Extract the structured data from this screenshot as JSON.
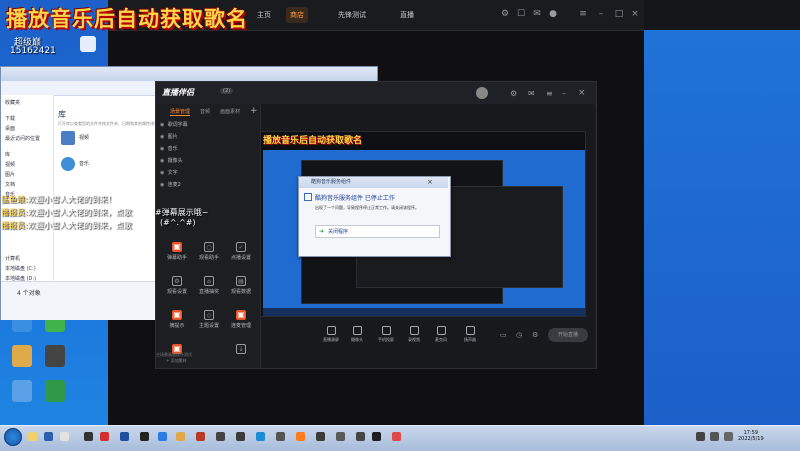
{
  "overlay": {
    "title": "播放音乐后自动获取歌名",
    "id_line1": "超级巅",
    "id_line2": "15162421"
  },
  "top_app": {
    "tabs": [
      "主页",
      "商店",
      "先锋测试",
      "直播"
    ]
  },
  "explorer": {
    "nav_items": [
      "收藏夹",
      "下载",
      "桌面",
      "最近访问的位置",
      "库",
      "视频",
      "图片",
      "文档",
      "音乐",
      "计算机",
      "本地磁盘 (C:)",
      "本地磁盘 (D:)",
      "网络"
    ],
    "library_title": "库",
    "library_subtitle": "打开库以查看您的文件并按文件夹、日期和其他属性排列它们。",
    "item_video": "视频",
    "item_music": "音乐",
    "status": "4 个对象"
  },
  "live_app": {
    "logo": "直播伴侣",
    "logo_badge": "(2)",
    "left_tabs": [
      "场景管理",
      "音频",
      "画面素材"
    ],
    "scenes": [
      "歌词字幕",
      "图片",
      "音乐",
      "摄像头",
      "文字",
      "连麦2"
    ],
    "tools": [
      {
        "label": "弹幕助手",
        "hot": true
      },
      {
        "label": "观看助手",
        "hot": false
      },
      {
        "label": "点播设置",
        "hot": false
      },
      {
        "label": "观看设置",
        "hot": false
      },
      {
        "label": "直播抽奖",
        "hot": false
      },
      {
        "label": "观看数据",
        "hot": false
      },
      {
        "label": "摘提示",
        "hot": true
      },
      {
        "label": "主题设置",
        "hot": false
      },
      {
        "label": "连麦管理",
        "hot": true
      },
      {
        "label": "更多",
        "hot": true
      },
      {
        "label": "更多工具",
        "hot": false
      }
    ],
    "add_material": "+ 添加素材",
    "bottom_tools": [
      "直播源屏",
      "摄像头",
      "手机投屏",
      "录视频",
      "麦克风",
      "扬声器"
    ],
    "start_live": "开始直播",
    "cpu": "主场景画面统计测试",
    "preview_title": "播放音乐后自动获取歌名"
  },
  "dialog": {
    "title": "酷狗音乐服务组件",
    "heading": "酷狗音乐服务组件 已停止工作",
    "message": "出现了一个问题，导致程序停止正常工作。请关闭该程序。",
    "button": "关闭程序"
  },
  "chat": [
    {
      "name": "猛鱼娘:",
      "text": "欢迎小雪人大佬的到来！"
    },
    {
      "name": "播报员:",
      "text": "欢迎小雪人大佬的到来，点歌"
    },
    {
      "name": "播报员:",
      "text": "欢迎小雪人大佬的到来，点歌"
    }
  ],
  "chat_extra": "#弹幕展示哦~",
  "chat_extra2": "(#^.^#)",
  "taskbar": {
    "time": "17:59",
    "date": "2022/5/19"
  }
}
